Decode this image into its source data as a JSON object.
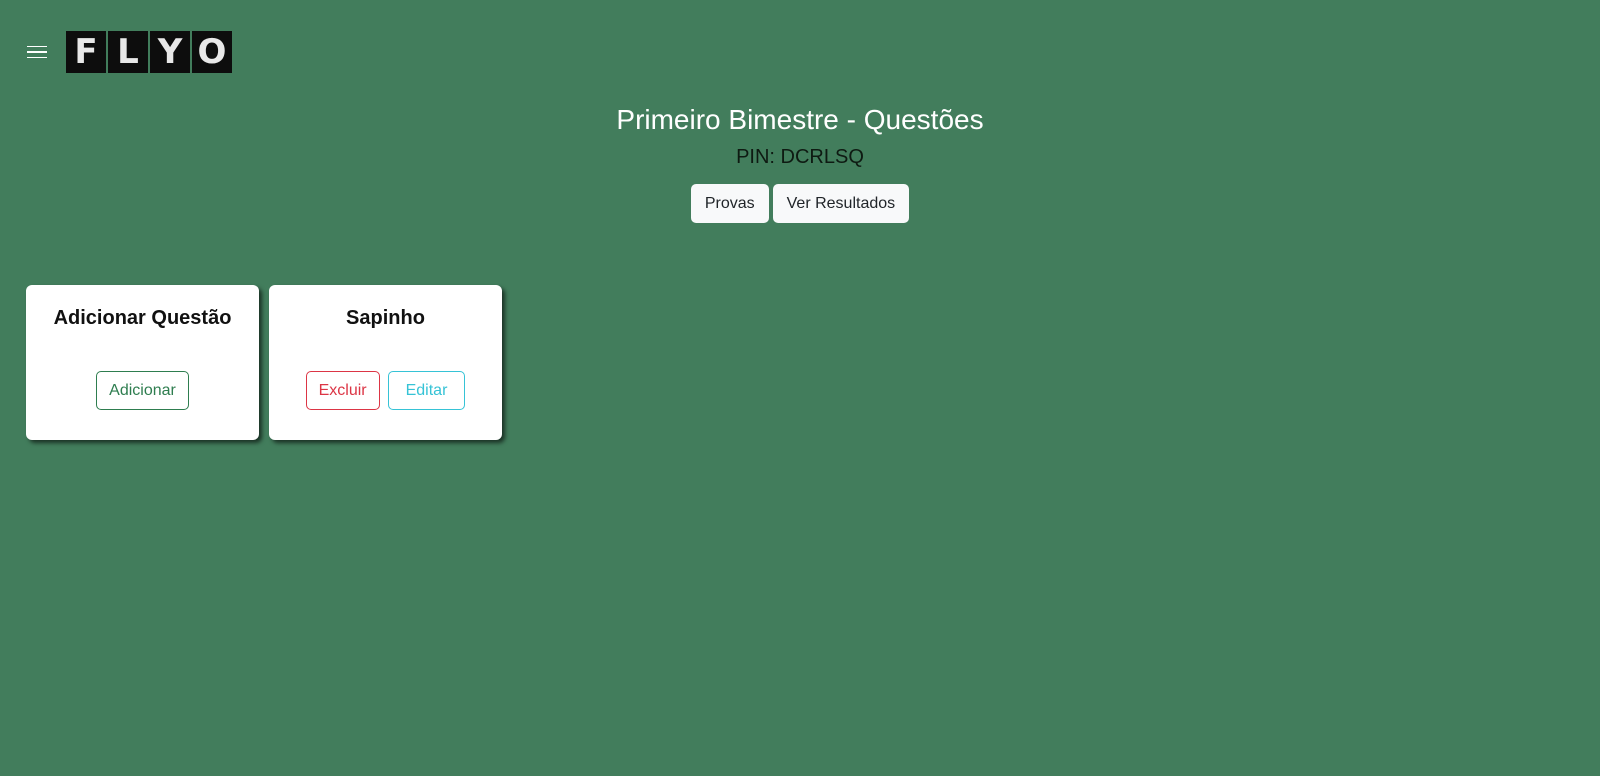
{
  "header": {
    "logo_letters": [
      "F",
      "L",
      "Y",
      "O"
    ]
  },
  "page": {
    "title": "Primeiro Bimestre - Questões",
    "pin": "PIN: DCRLSQ",
    "provas_label": "Provas",
    "results_label": "Ver Resultados"
  },
  "cards": [
    {
      "title": "Adicionar Questão",
      "add_label": "Adicionar"
    },
    {
      "title": "Sapinho",
      "delete_label": "Excluir",
      "edit_label": "Editar"
    }
  ],
  "colors": {
    "background": "#427d5c",
    "success": "#2e7d4f",
    "danger": "#dc3545",
    "info": "#36c3d6"
  },
  "icons": {
    "menu": "hamburger-menu-icon"
  }
}
